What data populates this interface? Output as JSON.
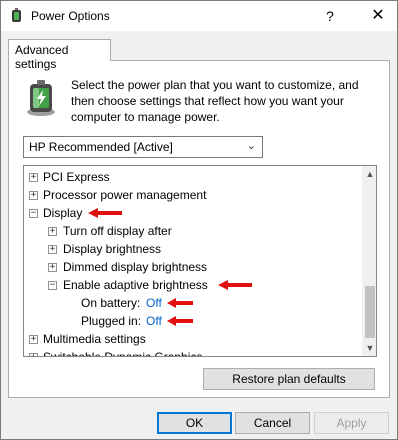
{
  "window": {
    "title": "Power Options",
    "help_glyph": "?",
    "close_glyph": "✕"
  },
  "tab": {
    "label": "Advanced settings"
  },
  "instruction": "Select the power plan that you want to customize, and then choose settings that reflect how you want your computer to manage power.",
  "plan_select": {
    "value": "HP Recommended [Active]"
  },
  "tree": {
    "items": [
      {
        "label": "PCI Express",
        "expander": "+"
      },
      {
        "label": "Processor power management",
        "expander": "+"
      },
      {
        "label": "Display",
        "expander": "−"
      },
      {
        "label": "Turn off display after",
        "expander": "+"
      },
      {
        "label": "Display brightness",
        "expander": "+"
      },
      {
        "label": "Dimmed display brightness",
        "expander": "+"
      },
      {
        "label": "Enable adaptive brightness",
        "expander": "−"
      },
      {
        "label": "On battery:",
        "value": "Off"
      },
      {
        "label": "Plugged in:",
        "value": "Off"
      },
      {
        "label": "Multimedia settings",
        "expander": "+"
      },
      {
        "label": "Switchable Dynamic Graphics",
        "expander": "+"
      }
    ]
  },
  "buttons": {
    "restore": "Restore plan defaults",
    "ok": "OK",
    "cancel": "Cancel",
    "apply": "Apply"
  },
  "colors": {
    "annotation_arrow": "#e01010",
    "link_value": "#0066cc",
    "focus_border": "#0078d7"
  }
}
